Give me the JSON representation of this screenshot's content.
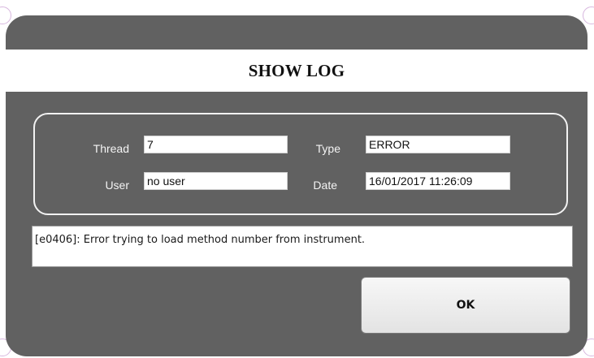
{
  "dialog": {
    "title": "SHOW LOG"
  },
  "fields": {
    "thread_label": "Thread",
    "thread_value": "7",
    "type_label": "Type",
    "type_value": "ERROR",
    "user_label": "User",
    "user_value": "no user",
    "date_label": "Date",
    "date_value": "16/01/2017 11:26:09"
  },
  "message": {
    "text": "[e0406]: Error trying to load method number from instrument."
  },
  "buttons": {
    "ok_label": "OK"
  },
  "colors": {
    "dialog_background": "#616161",
    "title_strip": "#ffffff",
    "panel_border": "#f2f2f2",
    "label_text": "#f4f4f4"
  }
}
